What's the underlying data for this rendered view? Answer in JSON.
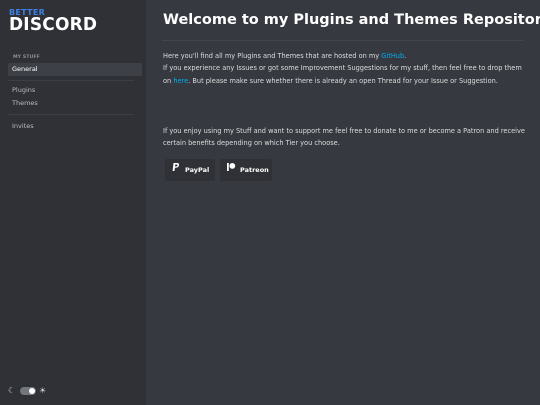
{
  "brand": {
    "line1": "BETTER",
    "line2": "DISCORD"
  },
  "sidebar": {
    "section_header": "MY STUFF",
    "items": [
      {
        "label": "General",
        "active": true
      },
      {
        "label": "Plugins"
      },
      {
        "label": "Themes"
      },
      {
        "label": "Invites"
      }
    ],
    "theme_toggle": {
      "moon_icon": "moon-icon",
      "sun_icon": "sun-icon",
      "state": "dark"
    }
  },
  "main": {
    "title": "Welcome to my Plugins and Themes Repository",
    "p1_a": "Here you'll find all my Plugins and Themes that are hosted on my ",
    "p1_link": "GitHub",
    "p1_b": ".",
    "p1_c": "If you experience any Issues or got some Improvement Suggestions for my stuff, then feel free to drop them on ",
    "p1_link2": "here",
    "p1_d": ". But please make sure whether there is already an open Thread for your Issue or Suggestion.",
    "p2": "If you enjoy using my Stuff and want to support me feel free to donate to me or become a Patron and receive certain benefits depending on which Tier you choose.",
    "buttons": [
      {
        "label": "PayPal",
        "icon": "paypal-icon"
      },
      {
        "label": "Patreon",
        "icon": "patreon-icon"
      }
    ]
  },
  "colors": {
    "accent": "#00b0f4",
    "brand_blue": "#3e82e5",
    "bg": "#36393f",
    "sidebar": "#2f3136"
  }
}
